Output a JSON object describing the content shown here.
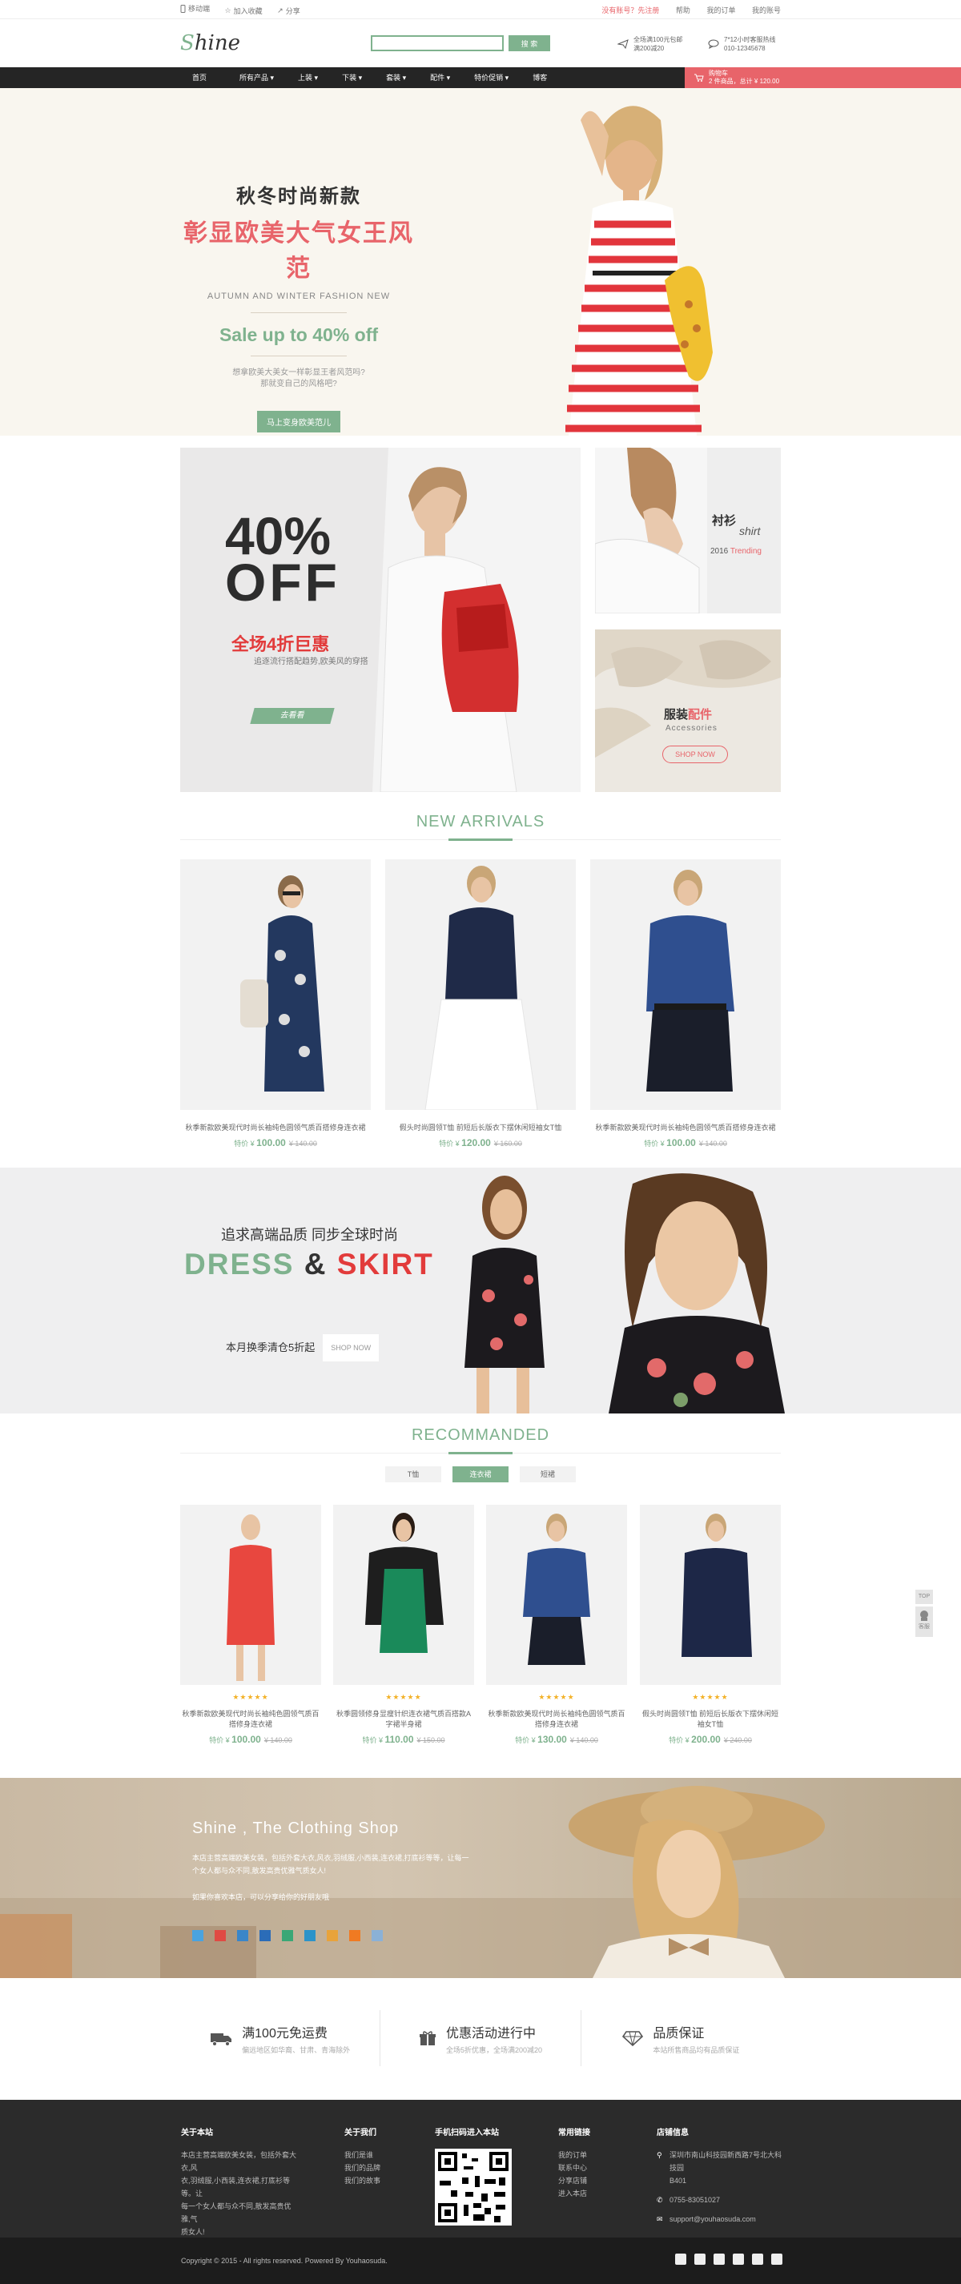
{
  "topbar": {
    "mobile": "移动端",
    "favorite": "加入收藏",
    "share": "分享",
    "register": "没有账号？先注册",
    "help": "帮助",
    "orders": "我的订单",
    "account": "我的账号"
  },
  "header": {
    "logo_s": "S",
    "logo_rest": "hine",
    "search_placeholder": "",
    "search_button": "搜 索",
    "ship_line1": "全场满100元包邮",
    "ship_line2": "满200减20",
    "service_line1": "7*12小时客服热线",
    "service_line2": "010-12345678"
  },
  "nav": {
    "items": [
      "首页",
      "所有产品 ▾",
      "上装 ▾",
      "下装 ▾",
      "套装 ▾",
      "配件 ▾",
      "特价促销 ▾",
      "博客"
    ],
    "cart_title": "购物车",
    "cart_info": "2 件商品，总计 ¥ 120.00"
  },
  "hero": {
    "title1": "秋冬时尚新款",
    "title2": "彰显欧美大气女王风范",
    "subtitle": "AUTUMN AND WINTER FASHION NEW",
    "sale": "Sale up to 40% off",
    "desc1": "想拿欧美大美女一样彰显王者风范吗?",
    "desc2": "那就变自己的风格吧?",
    "button": "马上变身欧美范儿"
  },
  "promo": {
    "big_pct": "40%",
    "big_off": "OFF",
    "big_cn": "全场4折巨惠",
    "big_desc": "追逐流行搭配趋势,欧美风的穿搭",
    "big_btn": "去看看",
    "shirt_cn": "衬衫",
    "shirt_en": "shirt",
    "shirt_year": "2016",
    "shirt_trend": "Trending",
    "acc_cn1": "服装",
    "acc_cn2": "配件",
    "acc_en": "Accessories",
    "acc_btn": "SHOP NOW"
  },
  "new_arrivals": {
    "title": "NEW ARRIVALS",
    "items": [
      {
        "name": "秋季新款欧美现代时尚长袖纯色圆领气质百搭修身连衣裙",
        "label": "特价",
        "price": "100.00",
        "old": "¥ 140.00"
      },
      {
        "name": "假头时尚圆领T恤 前短后长版衣下摆休闲短袖女T恤",
        "label": "特价",
        "price": "120.00",
        "old": "¥ 160.00"
      },
      {
        "name": "秋季新款欧美现代时尚长袖纯色圆领气质百搭修身连衣裙",
        "label": "特价",
        "price": "100.00",
        "old": "¥ 140.00"
      }
    ]
  },
  "dress": {
    "slogan": "追求高端品质 同步全球时尚",
    "word1": "DRESS",
    "amp": "&",
    "word2": "SKIRT",
    "offer": "本月换季清仓5折起",
    "btn": "SHOP NOW"
  },
  "recommended": {
    "title": "RECOMMANDED",
    "tabs": [
      "T恤",
      "连衣裙",
      "短裙"
    ],
    "items": [
      {
        "name": "秋季新款欧美现代时尚长袖纯色圆领气质百搭修身连衣裙",
        "label": "特价",
        "price": "100.00",
        "old": "¥ 140.00",
        "stars": "★★★★★"
      },
      {
        "name": "秋季圆领修身显瘦针织连衣裙气质百搭款A字裙半身裙",
        "label": "特价",
        "price": "110.00",
        "old": "¥ 150.00",
        "stars": "★★★★★"
      },
      {
        "name": "秋季新款欧美现代时尚长袖纯色圆领气质百搭修身连衣裙",
        "label": "特价",
        "price": "130.00",
        "old": "¥ 140.00",
        "stars": "★★★★★"
      },
      {
        "name": "假头时尚圆领T恤 前短后长版衣下摆休闲短袖女T恤",
        "label": "特价",
        "price": "200.00",
        "old": "¥ 240.00",
        "stars": "★★★★★"
      }
    ]
  },
  "brand": {
    "title": "Shine , The Clothing Shop",
    "desc1": "本店主营高端欧美女装，包括外套大衣,风衣,羽绒服,小西装,连衣裙,打底衫等等，让每一",
    "desc2": "个女人都与众不同,散发高贵优雅气质女人!",
    "weixin": "如果你喜欢本店，可以分享给你的好朋友哦"
  },
  "features": [
    {
      "title": "满100元免运费",
      "desc": "偏远地区如华裔、甘肃、青海除外"
    },
    {
      "title": "优惠活动进行中",
      "desc": "全场5折优惠，全场满200减20"
    },
    {
      "title": "品质保证",
      "desc": "本站所售商品均有品质保证"
    }
  ],
  "footer": {
    "about_title": "关于本站",
    "about_text": [
      "本店主营高端欧美女装，包括外套大衣,风",
      "衣,羽绒服,小西装,连衣裙,打底衫等等。让",
      "每一个女人都与众不同,散发高贵优雅,气",
      "质女人!"
    ],
    "us_title": "关于我们",
    "us_links": [
      "我们是谁",
      "我们的品牌",
      "我们的故事"
    ],
    "qr_title": "手机扫码进入本站",
    "help_title": "常用链接",
    "help_links": [
      "我的订单",
      "联系中心",
      "分享店铺",
      "进入本店"
    ],
    "contact_title": "店铺信息",
    "address": "深圳市南山科技园新西路7号北大科技园",
    "address2": "B401",
    "phone": "0755-83051027",
    "email": "support@youhaosuda.com"
  },
  "copyright": "Copyright © 2015 - All rights reserved.  Powered By Youhaosuda.",
  "side": {
    "top": "TOP",
    "service": "客服"
  },
  "colors": {
    "accent": "#7fb28e",
    "red": "#e8646a",
    "dark": "#252525"
  }
}
